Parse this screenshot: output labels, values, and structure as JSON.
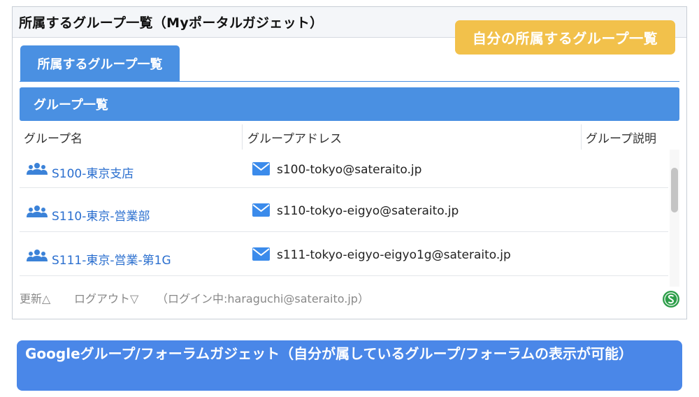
{
  "gadget": {
    "title": "所属するグループ一覧（Myポータルガジェット）"
  },
  "callout": "自分の所属するグループ一覧",
  "tab": {
    "label": "所属するグループ一覧"
  },
  "list_bar": "グループ一覧",
  "columns": {
    "name": "グループ名",
    "address": "グループアドレス",
    "description": "グループ説明"
  },
  "rows": [
    {
      "name": "S100-東京支店",
      "email": "s100-tokyo@sateraito.jp"
    },
    {
      "name": "S110-東京-営業部",
      "email": "s110-tokyo-eigyo@sateraito.jp"
    },
    {
      "name": "S111-東京-営業-第1G",
      "email": "s111-tokyo-eigyo-eigyo1g@sateraito.jp"
    }
  ],
  "footer": {
    "refresh": "更新△",
    "logout": "ログアウト▽",
    "login_status": "（ログイン中:haraguchi@sateraito.jp）"
  },
  "caption": "Googleグループ/フォーラムガジェット（自分が属しているグループ/フォーラムの表示が可能）",
  "colors": {
    "accent": "#4a90e2",
    "callout": "#f2c14b",
    "link": "#2b6fcf",
    "caption": "#4a87e8"
  }
}
